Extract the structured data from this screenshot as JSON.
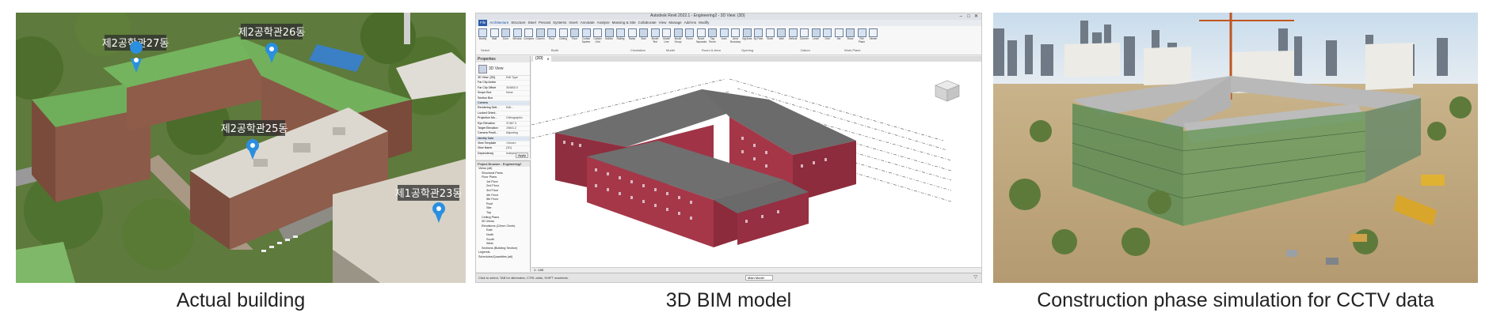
{
  "captions": {
    "actual": "Actual building",
    "bim": "3D BIM model",
    "sim": "Construction phase simulation for CCTV data"
  },
  "aerial": {
    "pins": [
      {
        "label": "제2공학관27동"
      },
      {
        "label": "제2공학관26동"
      },
      {
        "label": "제2공학관25동"
      },
      {
        "label": "제1공학관23동"
      }
    ]
  },
  "revit": {
    "title": "Autodesk Revit 2022.1 - Engineering2 - 3D View: {3D}",
    "menu": [
      "File",
      "Architecture",
      "Structure",
      "Steel",
      "Precast",
      "Systems",
      "Insert",
      "Annotate",
      "Analyze",
      "Massing & Site",
      "Collaborate",
      "View",
      "Manage",
      "Add-Ins",
      "Modify"
    ],
    "ribbon_groups": [
      "Select",
      "Build",
      "Circulation",
      "Model",
      "Room & Area",
      "Opening",
      "Datum",
      "Work Plane"
    ],
    "ribbon_tools": [
      "Modify",
      "Wall",
      "Door",
      "Window",
      "Component",
      "Column",
      "Roof",
      "Ceiling",
      "Floor",
      "Curtain System",
      "Curtain Grid",
      "Mullion",
      "Railing",
      "Ramp",
      "Stair",
      "Model Text",
      "Model Line",
      "Model Group",
      "Room",
      "Room Separator",
      "Tag Room",
      "Area",
      "Area Boundary",
      "Tag Area",
      "By Face",
      "Shaft",
      "Wall",
      "Vertical",
      "Dormer",
      "Level",
      "Grid",
      "Set",
      "Show",
      "Ref Plane",
      "Viewer"
    ],
    "view_tab": "{3D}",
    "properties_title": "Properties",
    "properties_type": "3D View",
    "properties_rows": [
      {
        "k": "3D View: {3D}",
        "v": "Edit Type"
      },
      {
        "k": "Far Clip Active",
        "v": ""
      },
      {
        "k": "Far Clip Offset",
        "v": "304800.0"
      },
      {
        "k": "Scope Box",
        "v": "None"
      },
      {
        "k": "Section Box",
        "v": ""
      },
      {
        "k": "Camera",
        "v": ""
      },
      {
        "k": "Rendering Sett...",
        "v": "Edit..."
      },
      {
        "k": "Locked Orient...",
        "v": ""
      },
      {
        "k": "Projection Mo...",
        "v": "Orthographic"
      },
      {
        "k": "Eye Elevation",
        "v": "37487.3"
      },
      {
        "k": "Target Elevation",
        "v": "19841.2"
      },
      {
        "k": "Camera Positi...",
        "v": "Adjusting"
      },
      {
        "k": "Identity Data",
        "v": ""
      },
      {
        "k": "View Template",
        "v": "<None>"
      },
      {
        "k": "View Name",
        "v": "{3D}"
      },
      {
        "k": "Dependency",
        "v": "Independent"
      }
    ],
    "properties_help": "Properties help",
    "apply": "Apply",
    "browser_title": "Project Browser - Engineering2",
    "browser_items": [
      "Views (all)",
      "Structural Plans",
      "Floor Plans",
      "1st Floor",
      "2nd Floor",
      "3rd Floor",
      "4th Floor",
      "5th Floor",
      "Roof",
      "Site",
      "Top",
      "Ceiling Plans",
      "3D Views",
      "Elevations (12mm Circle)",
      "East",
      "North",
      "South",
      "West",
      "Sections (Building Section)",
      "Legends",
      "Schedules/Quantities (all)"
    ],
    "status": "Click to select, TAB for alternates, CTRL adds, SHIFT unselects.",
    "scale": "1 : 100",
    "main_model": "Main Model"
  }
}
